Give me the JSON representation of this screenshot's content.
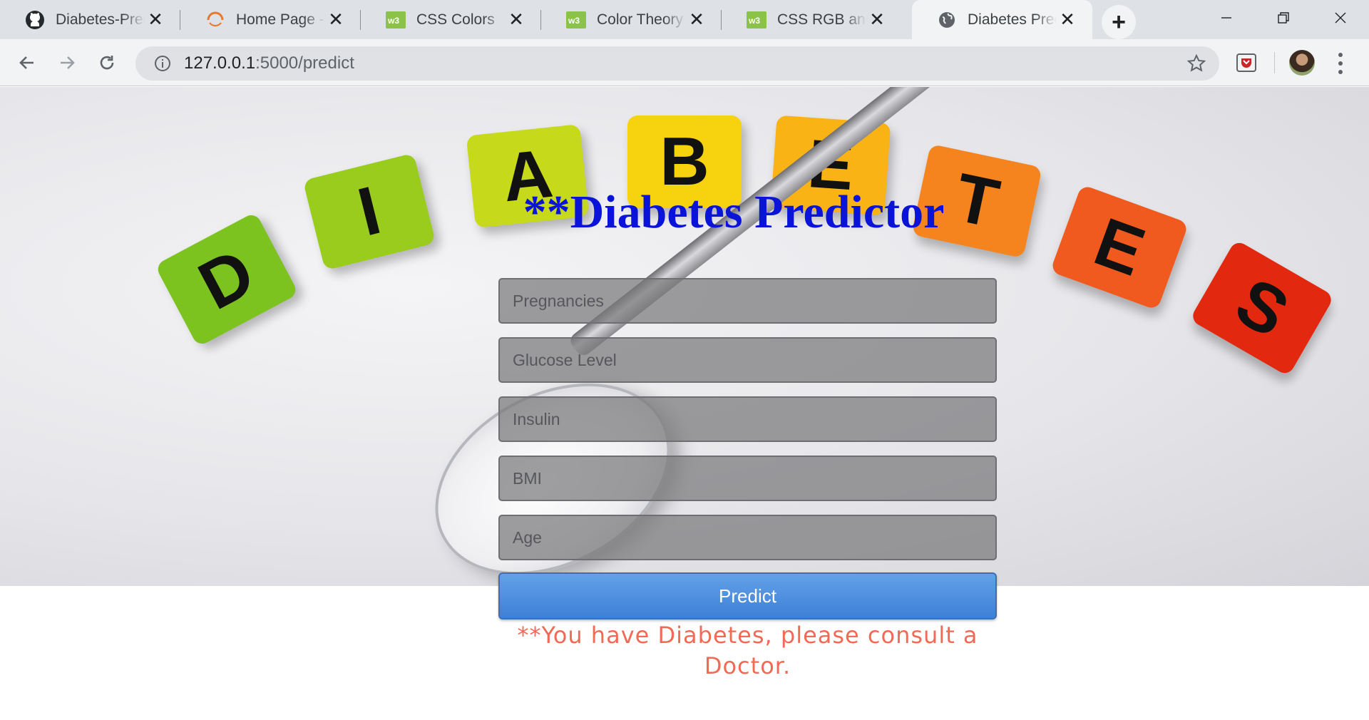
{
  "browser": {
    "tabs": [
      {
        "title": "Diabetes-Prediction",
        "favicon": "github-icon",
        "active": false
      },
      {
        "title": "Home Page - Sublime",
        "favicon": "loading-ring-icon",
        "active": false
      },
      {
        "title": "CSS Colors",
        "favicon": "w3schools-icon",
        "active": false
      },
      {
        "title": "Color Theory",
        "favicon": "w3schools-icon",
        "active": false
      },
      {
        "title": "CSS RGB and RGBA",
        "favicon": "w3schools-icon",
        "active": false
      },
      {
        "title": "Diabetes Predictor",
        "favicon": "globe-icon",
        "active": true
      }
    ],
    "url_host": "127.0.0.1",
    "url_path": ":5000/predict"
  },
  "page": {
    "heading": "**Diabetes Predictor",
    "hero_letters": [
      "D",
      "I",
      "A",
      "B",
      "E",
      "T",
      "E",
      "S"
    ],
    "fields": [
      {
        "placeholder": "Pregnancies"
      },
      {
        "placeholder": "Glucose Level"
      },
      {
        "placeholder": "Insulin"
      },
      {
        "placeholder": "BMI"
      },
      {
        "placeholder": "Age"
      }
    ],
    "predict_label": "Predict",
    "result": "**You have Diabetes, please consult a Doctor."
  },
  "colors": {
    "heading": "#0a14d8",
    "result": "#f06a55",
    "button": "#4a8ede"
  }
}
